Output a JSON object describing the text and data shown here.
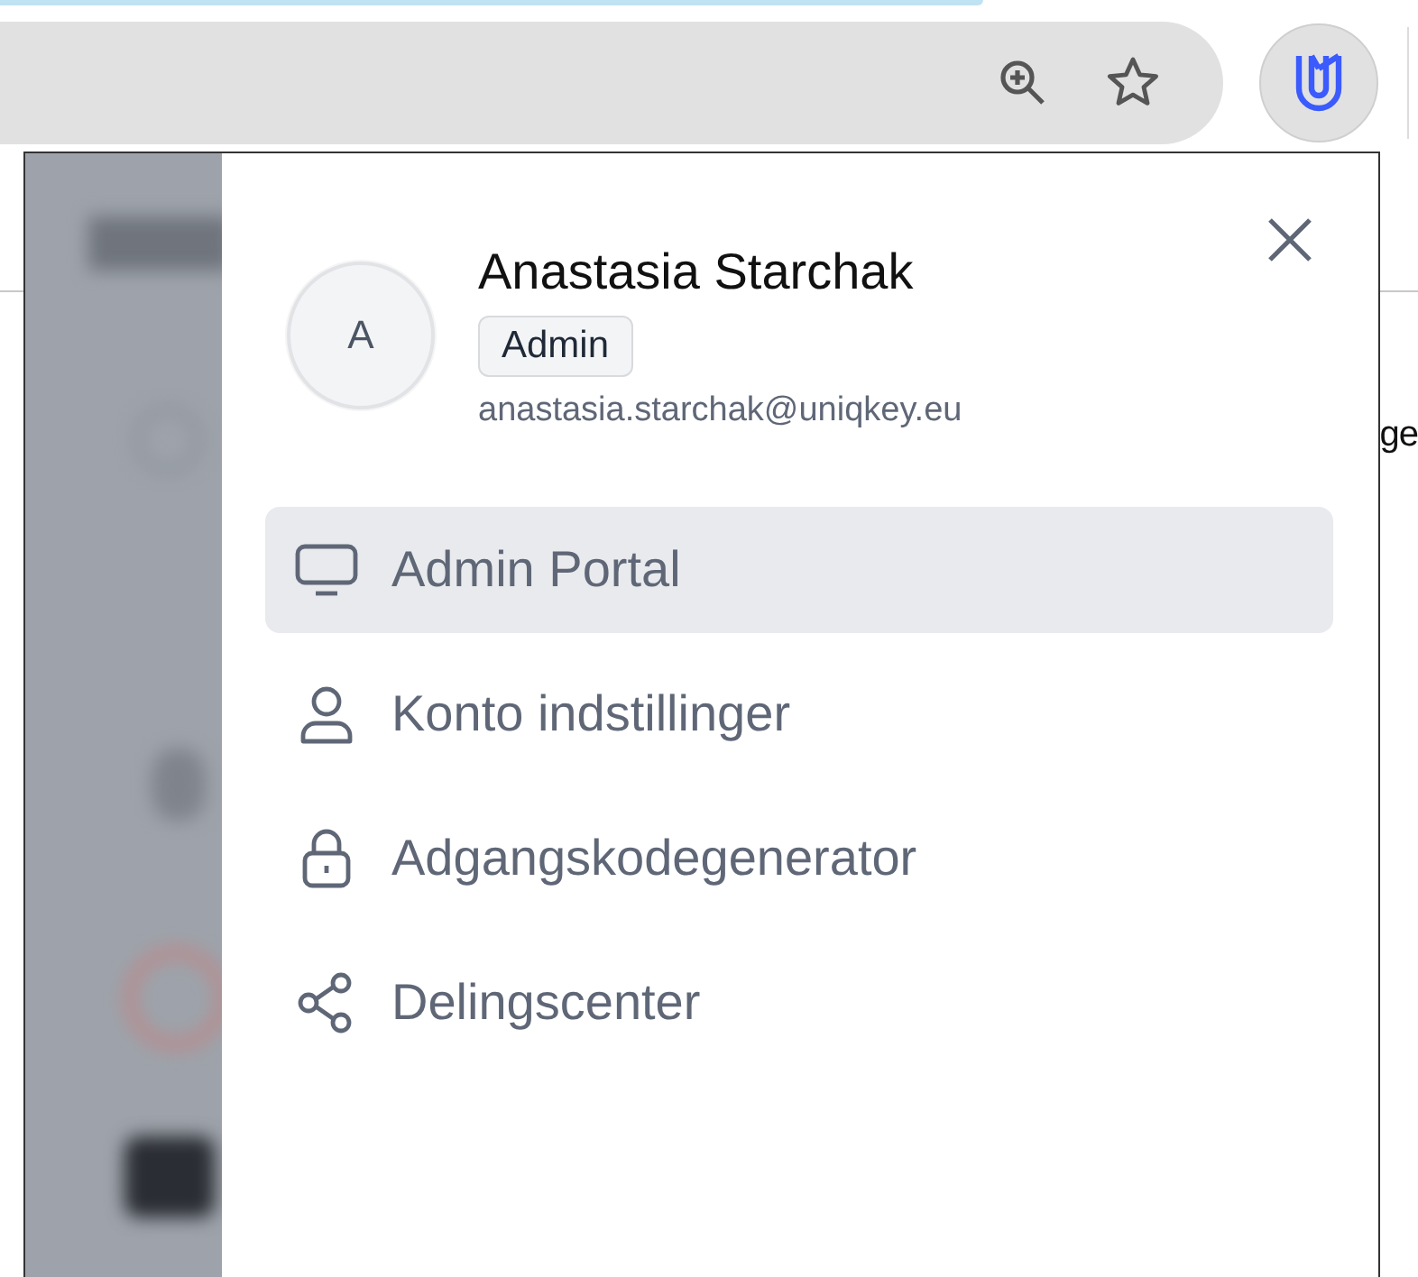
{
  "browser": {
    "page_text_fragment": "ge"
  },
  "profile": {
    "initial": "A",
    "name": "Anastasia Starchak",
    "role": "Admin",
    "email": "anastasia.starchak@uniqkey.eu"
  },
  "menu": [
    {
      "kind": "monitor",
      "label": "Admin Portal",
      "selected": true
    },
    {
      "kind": "user",
      "label": "Konto indstillinger",
      "selected": false
    },
    {
      "kind": "lock",
      "label": "Adgangskodegenerator",
      "selected": false
    },
    {
      "kind": "share",
      "label": "Delingscenter",
      "selected": false
    }
  ]
}
